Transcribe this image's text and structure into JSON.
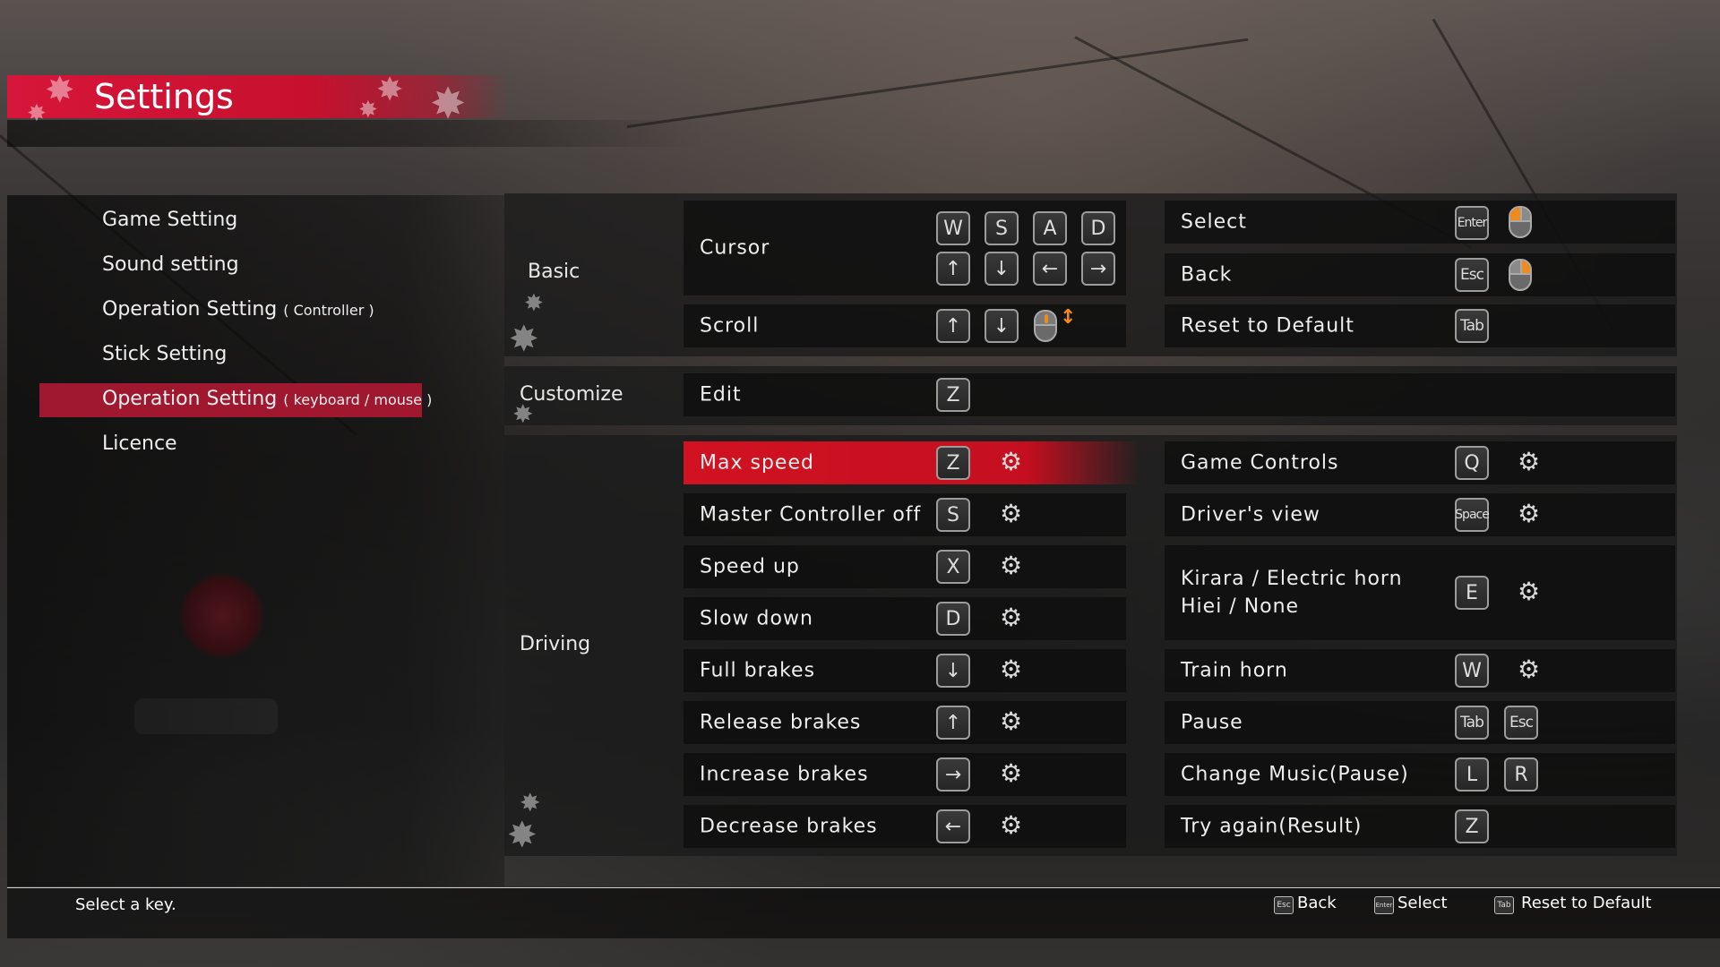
{
  "header": {
    "title": "Settings"
  },
  "sidebar": {
    "items": [
      {
        "label": "Game Setting",
        "suffix": ""
      },
      {
        "label": "Sound setting",
        "suffix": ""
      },
      {
        "label": "Operation Setting",
        "suffix": "( Controller )"
      },
      {
        "label": "Stick Setting",
        "suffix": ""
      },
      {
        "label": "Operation Setting",
        "suffix": "( keyboard / mouse )"
      },
      {
        "label": "Licence",
        "suffix": ""
      }
    ],
    "active_index": 4
  },
  "basic": {
    "label": "Basic",
    "cursor": {
      "label": "Cursor",
      "keys_top": [
        "W",
        "S",
        "A",
        "D"
      ],
      "keys_bottom": [
        "↑",
        "↓",
        "←",
        "→"
      ]
    },
    "scroll": {
      "label": "Scroll",
      "keys": [
        "↑",
        "↓"
      ]
    },
    "select": {
      "label": "Select",
      "key": "Enter"
    },
    "back": {
      "label": "Back",
      "key": "Esc"
    },
    "reset": {
      "label": "Reset to Default",
      "key": "Tab"
    }
  },
  "customize": {
    "label": "Customize",
    "edit": {
      "label": "Edit",
      "key": "Z"
    }
  },
  "driving": {
    "label": "Driving",
    "left": [
      {
        "label": "Max speed",
        "key": "Z"
      },
      {
        "label": "Master Controller off",
        "key": "S"
      },
      {
        "label": "Speed up",
        "key": "X"
      },
      {
        "label": "Slow down",
        "key": "D"
      },
      {
        "label": "Full brakes",
        "key": "↓"
      },
      {
        "label": "Release brakes",
        "key": "↑"
      },
      {
        "label": "Increase brakes",
        "key": "→"
      },
      {
        "label": "Decrease brakes",
        "key": "←"
      }
    ],
    "right": [
      {
        "label": "Game Controls",
        "keys": [
          "Q"
        ],
        "gear": true
      },
      {
        "label": "Driver's view",
        "keys": [
          "Space"
        ],
        "gear": true
      },
      {
        "label": "Kirara / Electric horn",
        "label2": "Hiei / None",
        "keys": [
          "E"
        ],
        "gear": true
      },
      {
        "label": "Train horn",
        "keys": [
          "W"
        ],
        "gear": true
      },
      {
        "label": "Pause",
        "keys": [
          "Tab",
          "Esc"
        ],
        "gear": false
      },
      {
        "label": "Change Music(Pause)",
        "keys": [
          "L",
          "R"
        ],
        "gear": false
      },
      {
        "label": "Try again(Result)",
        "keys": [
          "Z"
        ],
        "gear": false
      }
    ]
  },
  "footer": {
    "hint": "Select a key.",
    "back": {
      "key": "Esc",
      "label": "Back"
    },
    "select": {
      "key": "Enter",
      "label": "Select"
    },
    "reset": {
      "key": "Tab",
      "label": "Reset to Default"
    }
  },
  "colors": {
    "accent": "#c8102e",
    "mouse_highlight": "#f08a1a"
  }
}
